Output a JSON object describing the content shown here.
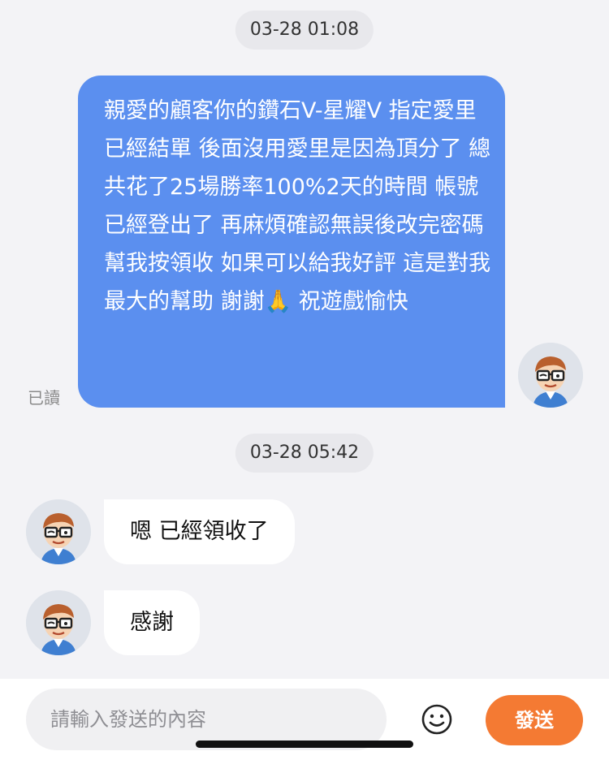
{
  "messages": [
    {
      "type": "timestamp",
      "text": "03-28 01:08"
    },
    {
      "type": "outgoing",
      "text": "親愛的顧客你的鑽石V-星耀V 指定愛里已經結單 後面沒用愛里是因為頂分了 總共花了25場勝率100%2天的時間 帳號已經登出了 再麻煩確認無誤後改完密碼幫我按領收 如果可以給我好評 這是對我最大的幫助 謝謝🙏 祝遊戲愉快",
      "status": "已讀"
    },
    {
      "type": "timestamp",
      "text": "03-28 05:42"
    },
    {
      "type": "incoming",
      "text": "嗯 已經領收了"
    },
    {
      "type": "incoming",
      "text": "感謝"
    }
  ],
  "input": {
    "placeholder": "請輸入發送的內容"
  },
  "send_button": {
    "label": "發送"
  },
  "icons": {
    "emoji": "smiley-icon",
    "avatar": "avatar-glasses-icon"
  },
  "colors": {
    "outgoing_bubble": "#5b8fef",
    "send_button": "#f47a33",
    "background": "#f3f3f6"
  }
}
